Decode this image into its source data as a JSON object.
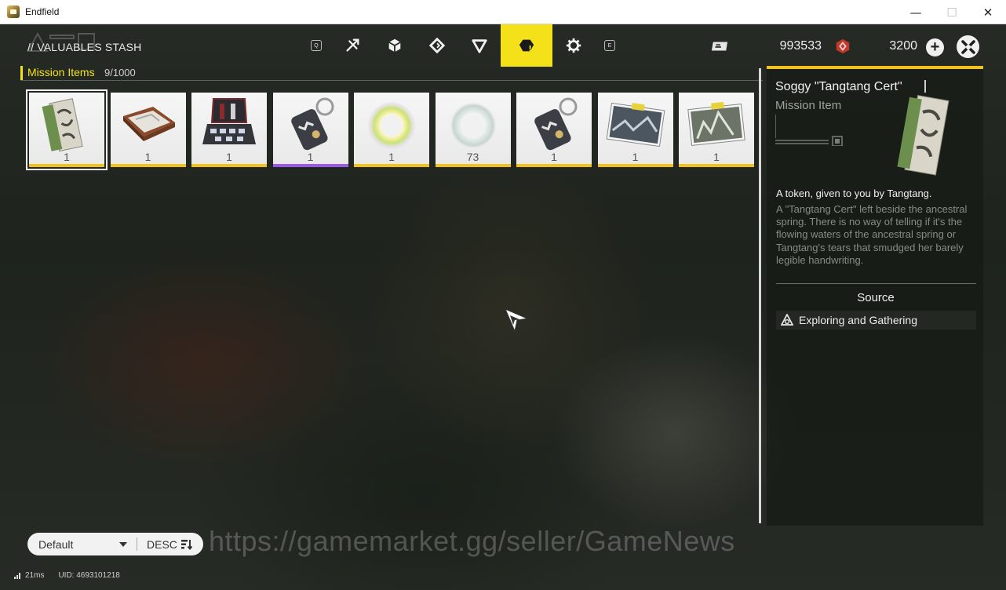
{
  "window": {
    "title": "Endfield",
    "minimize": "—",
    "maximize": "☐",
    "close": "✕"
  },
  "header": {
    "stash_title": "// VALUABLES STASH",
    "nav_prev_key": "Q",
    "nav_next_key": "E",
    "tabs": [
      {
        "icon": "feather-cross-icon",
        "active": false
      },
      {
        "icon": "cube-icon",
        "active": false
      },
      {
        "icon": "diamond-ring-icon",
        "active": false
      },
      {
        "icon": "triangle-icon",
        "active": false
      },
      {
        "icon": "mission-box-icon",
        "active": true
      },
      {
        "icon": "gear-icon",
        "active": false
      }
    ],
    "currency_1": {
      "icon": "credit-card-icon",
      "value": "993533"
    },
    "currency_2": {
      "icon": "origeometry-icon",
      "value": "3200"
    },
    "plus_label": "+"
  },
  "category": {
    "name": "Mission Items",
    "count": "9/1000"
  },
  "items": [
    {
      "name": "soggy-tangtang-cert",
      "qty": "1",
      "rarity": "gold",
      "selected": true
    },
    {
      "name": "wooden-tray",
      "qty": "1",
      "rarity": "gold",
      "selected": false
    },
    {
      "name": "open-case",
      "qty": "1",
      "rarity": "gold",
      "selected": false
    },
    {
      "name": "tag-keychain",
      "qty": "1",
      "rarity": "purple",
      "selected": false
    },
    {
      "name": "iridescent-ring",
      "qty": "1",
      "rarity": "gold",
      "selected": false
    },
    {
      "name": "clear-ring",
      "qty": "73",
      "rarity": "gold",
      "selected": false
    },
    {
      "name": "tag-keychain-2",
      "qty": "1",
      "rarity": "gold",
      "selected": false
    },
    {
      "name": "photo-1",
      "qty": "1",
      "rarity": "gold",
      "selected": false
    },
    {
      "name": "photo-2",
      "qty": "1",
      "rarity": "gold",
      "selected": false
    }
  ],
  "detail": {
    "title": "Soggy \"Tangtang Cert\"",
    "type": "Mission Item",
    "description": "A token, given to you by Tangtang.",
    "lore": "A \"Tangtang Cert\" left beside the ancestral spring. There is no way of telling if it's the flowing waters of the ancestral spring or Tangtang's tears that smudged her barely legible handwriting.",
    "source_heading": "Source",
    "source": "Exploring and Gathering"
  },
  "sort": {
    "value": "Default",
    "order": "DESC"
  },
  "watermark": "https://gamemarket.gg/seller/GameNews",
  "footer": {
    "ping": "21ms",
    "uid": "UID: 4693101218"
  },
  "colors": {
    "accent": "#f5e11a",
    "gold": "#f1c21b",
    "purple": "#9b59e8"
  }
}
